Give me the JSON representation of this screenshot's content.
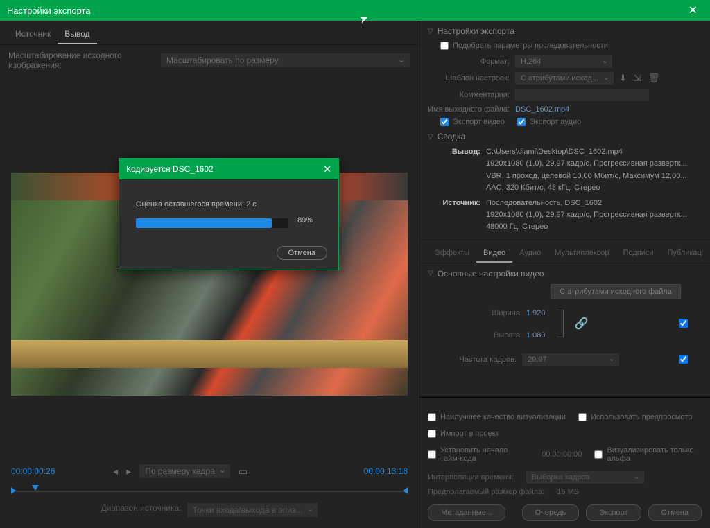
{
  "window": {
    "title": "Настройки экспорта",
    "close": "✕"
  },
  "left": {
    "tabs": {
      "source": "Источник",
      "output": "Вывод"
    },
    "scale_label": "Масштабирование исходного изображения:",
    "scale_value": "Масштабировать по размеру",
    "time_left": "00:00:00:26",
    "time_right": "00:00:13:18",
    "fit": "По размеру кадра",
    "src_range_label": "Диапазон источника:",
    "src_range_value": "Точки входа/выхода в эпиз..."
  },
  "right": {
    "header": "Настройки экспорта",
    "match_seq": "Подобрать параметры последовательности",
    "format_label": "Формат:",
    "format_value": "H.264",
    "preset_label": "Шаблон настроек:",
    "preset_value": "С атрибутами исход...",
    "comments_label": "Комментарии:",
    "outname_label": "Имя выходного файла:",
    "outname_value": "DSC_1602.mp4",
    "export_video": "Экспорт видео",
    "export_audio": "Экспорт аудио",
    "summary_header": "Сводка",
    "summary_out_label": "Вывод:",
    "summary_out_1": "C:\\Users\\diami\\Desktop\\DSC_1602.mp4",
    "summary_out_2": "1920x1080 (1,0), 29,97 кадр/с, Прогрессивная развертк...",
    "summary_out_3": "VBR, 1 проход, целевой 10,00 Мбит/с, Максимум 12,00...",
    "summary_out_4": "AAC, 320 Кбит/с, 48 кГц, Стерео",
    "summary_src_label": "Источник:",
    "summary_src_1": "Последовательность, DSC_1602",
    "summary_src_2": "1920x1080 (1,0), 29,97 кадр/с, Прогрессивная развертк...",
    "summary_src_3": "48000 Гц, Стерео",
    "tabs2": {
      "effects": "Эффекты",
      "video": "Видео",
      "audio": "Аудио",
      "mux": "Мультиплексор",
      "captions": "Подписи",
      "publish": "Публикац"
    },
    "video_panel_header": "Основные настройки видео",
    "match_source_btn": "С атрибутами исходного файла",
    "width_label": "Ширина:",
    "width_value": "1 920",
    "height_label": "Высота:",
    "height_value": "1 080",
    "fps_label": "Частота кадров:",
    "fps_value": "29,97"
  },
  "bottom": {
    "best_quality": "Наилучшее качество визуализации",
    "use_preview": "Использовать предпросмотр",
    "import_project": "Импорт в проект",
    "set_tc": "Установить начало тайм-кода",
    "tc_value": "00:00:00:00",
    "alpha_only": "Визуализировать только альфа",
    "interp_label": "Интерполяция времени:",
    "interp_value": "Выборка кадров",
    "est_size_label": "Предполагаемый размер файла:",
    "est_size_value": "16 МБ",
    "metadata_btn": "Метаданные...",
    "queue_btn": "Очередь",
    "export_btn": "Экспорт",
    "cancel_btn": "Отмена"
  },
  "modal": {
    "title": "Кодируется DSC_1602",
    "close": "✕",
    "est_label": "Оценка оставшегося времени: 2 с",
    "percent": "89%",
    "cancel": "Отмена"
  }
}
